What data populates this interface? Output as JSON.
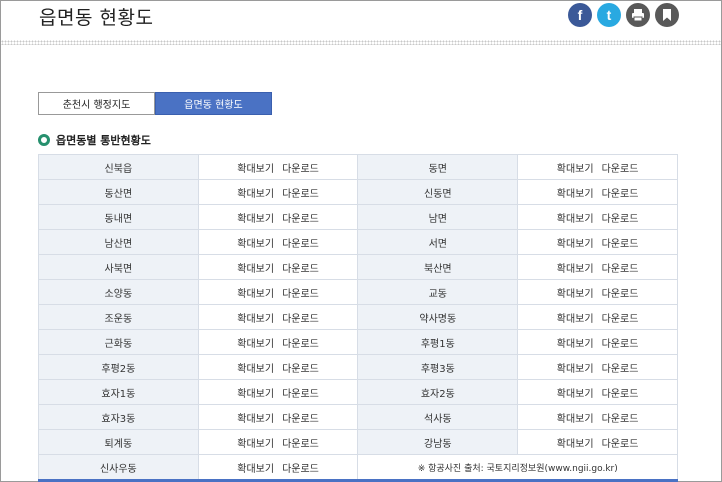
{
  "page": {
    "title": "읍면동 현황도"
  },
  "share": {
    "facebook": "f",
    "twitter": "t"
  },
  "tabs": [
    {
      "label": "춘천시 행정지도"
    },
    {
      "label": "읍면동 현황도"
    }
  ],
  "section": {
    "title": "읍면동별 통반현황도"
  },
  "actions": {
    "zoom": "확대보기",
    "download": "다운로드"
  },
  "rows": [
    [
      "신북읍",
      "동면"
    ],
    [
      "동산면",
      "신동면"
    ],
    [
      "동내면",
      "남면"
    ],
    [
      "남산면",
      "서면"
    ],
    [
      "사북면",
      "북산면"
    ],
    [
      "소양동",
      "교동"
    ],
    [
      "조운동",
      "약사명동"
    ],
    [
      "근화동",
      "후평1동"
    ],
    [
      "후평2동",
      "후평3동"
    ],
    [
      "효자1동",
      "효자2동"
    ],
    [
      "효자3동",
      "석사동"
    ],
    [
      "퇴계동",
      "강남동"
    ]
  ],
  "last_row": {
    "name": "신사우동",
    "source": "※ 항공사진 출처: 국토지리정보원(www.ngii.go.kr)"
  }
}
